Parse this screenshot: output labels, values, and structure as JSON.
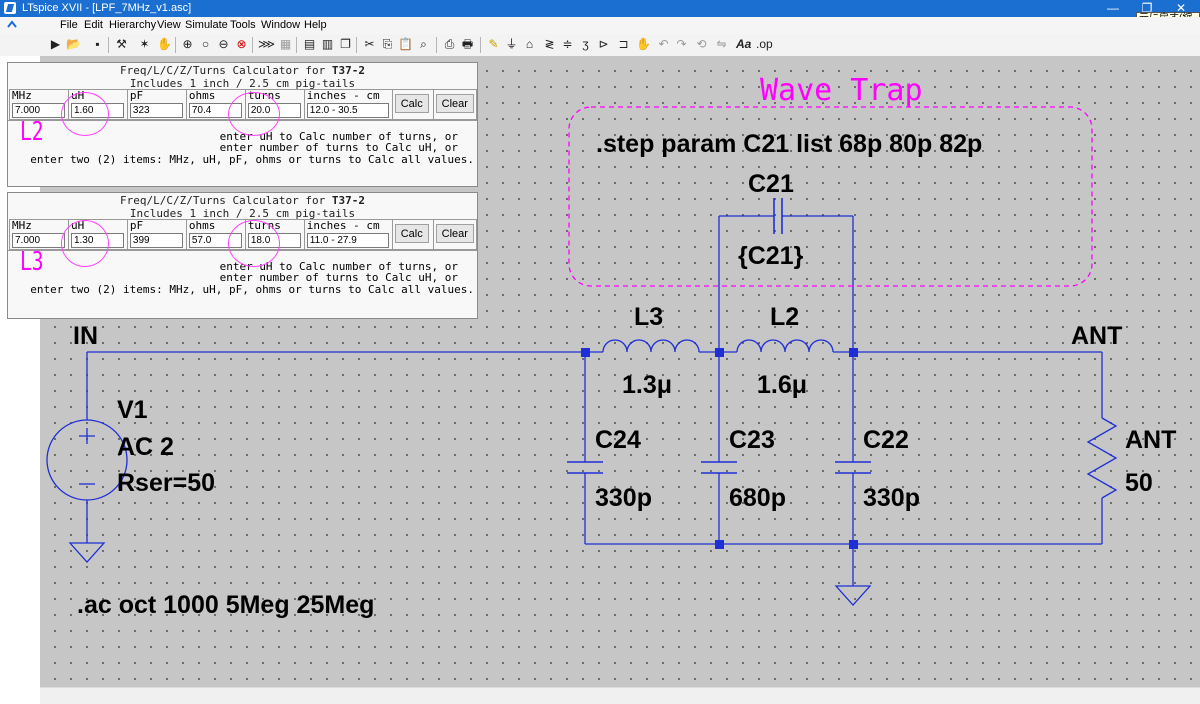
{
  "window": {
    "title": "LTspice XVII - [LPF_7MHz_v1.asc]",
    "restore_tooltip": "元に戻す(縮小)"
  },
  "menu": [
    "File",
    "Edit",
    "Hierarchy",
    "View",
    "Simulate",
    "Tools",
    "Window",
    "Help"
  ],
  "calculators": [
    {
      "title_prefix": "Freq/L/C/Z/Turns Calculator for ",
      "core": "T37-2",
      "subtitle": "Includes 1 inch / 2.5 cm pig-tails",
      "headers": [
        "MHz",
        "uH",
        "pF",
        "ohms",
        "turns",
        "inches - cm"
      ],
      "values": {
        "mhz": "7.000",
        "uh": "1.60",
        "pf": "323",
        "ohms": "70.4",
        "turns": "20.0",
        "inches_cm": "12.0 - 30.5"
      },
      "calc_label": "Calc",
      "clear_label": "Clear",
      "annotation": "L2",
      "help": [
        "enter uH to Calc number of turns, or",
        "enter number of turns to Calc uH, or",
        "enter two (2) items: MHz, uH, pF, ohms or turns to Calc all values."
      ]
    },
    {
      "title_prefix": "Freq/L/C/Z/Turns Calculator for ",
      "core": "T37-2",
      "subtitle": "Includes 1 inch / 2.5 cm pig-tails",
      "headers": [
        "MHz",
        "uH",
        "pF",
        "ohms",
        "turns",
        "inches - cm"
      ],
      "values": {
        "mhz": "7.000",
        "uh": "1.30",
        "pf": "399",
        "ohms": "57.0",
        "turns": "18.0",
        "inches_cm": "11.0 - 27.9"
      },
      "calc_label": "Calc",
      "clear_label": "Clear",
      "annotation": "L3",
      "help": [
        "enter uH to Calc number of turns, or",
        "enter number of turns to Calc uH, or",
        "enter two (2) items: MHz, uH, pF, ohms or turns to Calc all values."
      ]
    }
  ],
  "schematic": {
    "wave_trap_label": "Wave Trap",
    "step_directive": ".step param C21 list 68p 80p 82p",
    "ac_directive": ".ac oct 1000 5Meg 25Meg",
    "net_in": "IN",
    "net_ant": "ANT",
    "source": {
      "name": "V1",
      "value": "AC 2",
      "rser": "Rser=50"
    },
    "c21": {
      "name": "C21",
      "value": "{C21}"
    },
    "l3": {
      "name": "L3",
      "value": "1.3μ"
    },
    "l2": {
      "name": "L2",
      "value": "1.6μ"
    },
    "c24": {
      "name": "C24",
      "value": "330p"
    },
    "c23": {
      "name": "C23",
      "value": "680p"
    },
    "c22": {
      "name": "C22",
      "value": "330p"
    },
    "rload": {
      "name": "ANT",
      "value": "50"
    }
  },
  "colors": {
    "wire": "#1f2fd6",
    "accent": "#ff00ff",
    "canvas": "#c6c6c6",
    "titlebar": "#1b6fd1"
  }
}
